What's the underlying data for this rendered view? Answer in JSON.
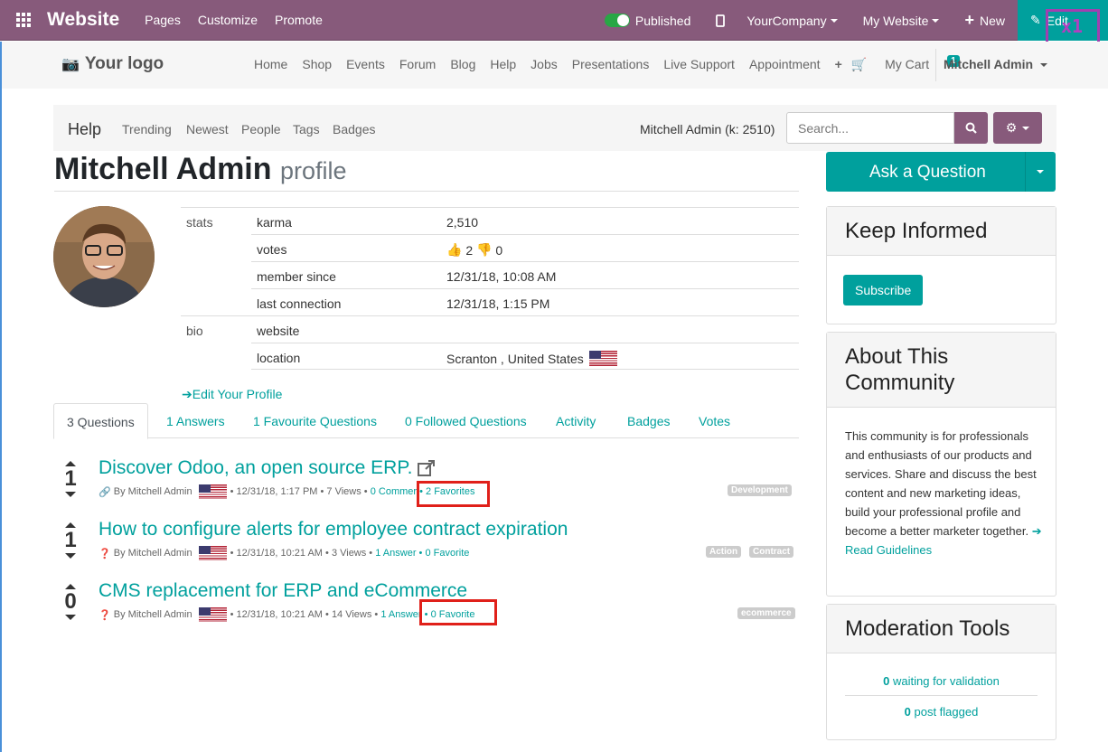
{
  "topbar": {
    "brand": "Website",
    "menus": [
      "Pages",
      "Customize",
      "Promote"
    ],
    "published": "Published",
    "company": "YourCompany",
    "my_website": "My Website",
    "new": "New",
    "edit": "Edit",
    "overlay": "x1"
  },
  "navbar": {
    "logo": "Your logo",
    "links": [
      "Home",
      "Shop",
      "Events",
      "Forum",
      "Blog",
      "Help",
      "Jobs",
      "Presentations",
      "Live Support",
      "Appointment"
    ],
    "cart": "My Cart",
    "cart_count": "1",
    "user": "Mitchell Admin"
  },
  "forumbar": {
    "title": "Help",
    "links": [
      "Trending",
      "Newest",
      "People",
      "Tags",
      "Badges"
    ],
    "karma": "Mitchell Admin (k: 2510)",
    "search_placeholder": "Search..."
  },
  "profile": {
    "name": "Mitchell Admin",
    "sub": "profile",
    "stats_label": "stats",
    "bio_label": "bio",
    "karma_label": "karma",
    "karma": "2,510",
    "votes_label": "votes",
    "votes_up": "2",
    "votes_down": "0",
    "member_label": "member since",
    "member_since": "12/31/18, 10:08 AM",
    "last_label": "last connection",
    "last_connection": "12/31/18, 1:15 PM",
    "website_label": "website",
    "location_label": "location",
    "location": "Scranton , United States",
    "edit_profile": "Edit Your Profile"
  },
  "tabs": [
    "3 Questions",
    "1 Answers",
    "1 Favourite Questions",
    "0 Followed Questions",
    "Activity",
    "Badges",
    "Votes"
  ],
  "questions": [
    {
      "votes": "1",
      "title": "Discover Odoo, an open source ERP.",
      "by": "By Mitchell Admin",
      "date": "• 12/31/18, 1:17 PM",
      "views": "• 7 Views •",
      "comments": "0 Commer",
      "fav": "• 2 Favorites",
      "tags": [
        "Development"
      ]
    },
    {
      "votes": "1",
      "title": "How to configure alerts for employee contract expiration",
      "by": "By Mitchell Admin",
      "date": "• 12/31/18, 10:21 AM",
      "views": "• 3 Views •",
      "comments": "1 Answer",
      "fav": "• 0 Favorite",
      "tags": [
        "Action",
        "Contract"
      ]
    },
    {
      "votes": "0",
      "title": "CMS replacement for ERP and eCommerce",
      "by": "By Mitchell Admin",
      "date": "• 12/31/18, 10:21 AM",
      "views": "• 14 Views •",
      "comments": "1 Answer",
      "fav": "• 0 Favorite",
      "tags": [
        "ecommerce"
      ]
    }
  ],
  "sidebar": {
    "ask": "Ask a Question",
    "keep_informed": "Keep Informed",
    "subscribe": "Subscribe",
    "about_title": "About This Community",
    "about_text": "This community is for professionals and enthusiasts of our products and services. Share and discuss the best content and new marketing ideas, build your professional profile and become a better marketer together.",
    "read_guidelines": "Read Guidelines",
    "moderation_title": "Moderation Tools",
    "waiting_count": "0",
    "waiting_label": "waiting for validation",
    "flagged_count": "0",
    "flagged_label": "post flagged"
  },
  "colors": {
    "topbar": "#875a7b",
    "accent": "#00a09d",
    "highlight": "#e0201a",
    "overlay": "#a040b0"
  }
}
